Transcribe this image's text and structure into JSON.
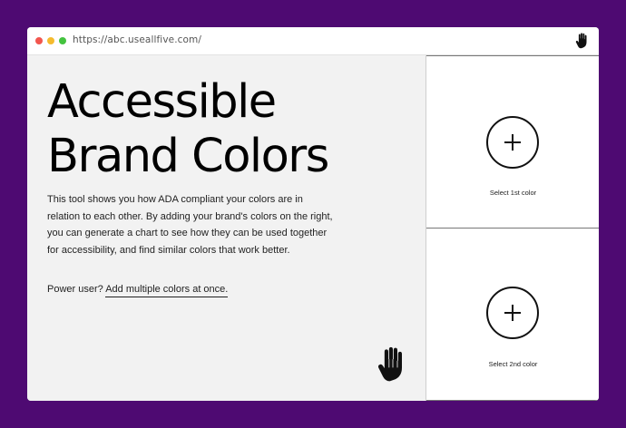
{
  "browser": {
    "url": "https://abc.useallfive.com/"
  },
  "hero": {
    "title_line1": "Accessible",
    "title_line2": "Brand Colors",
    "description": "This tool shows you how ADA compliant your colors are in relation to each other. By adding your brand's colors on the right, you can generate a chart to see how they can be used together for accessibility, and find similar colors that work better.",
    "power_prefix": "Power user?",
    "power_link": "Add multiple colors at once."
  },
  "color_slots": [
    {
      "label": "Select 1st color",
      "icon": "plus-icon"
    },
    {
      "label": "Select 2nd color",
      "icon": "plus-icon"
    }
  ],
  "icons": {
    "titlebar": "hand-icon",
    "logo": "hand-icon"
  },
  "colors": {
    "background": "#4e0a72",
    "panel": "#f2f2f2",
    "white": "#ffffff",
    "text": "#000000"
  }
}
